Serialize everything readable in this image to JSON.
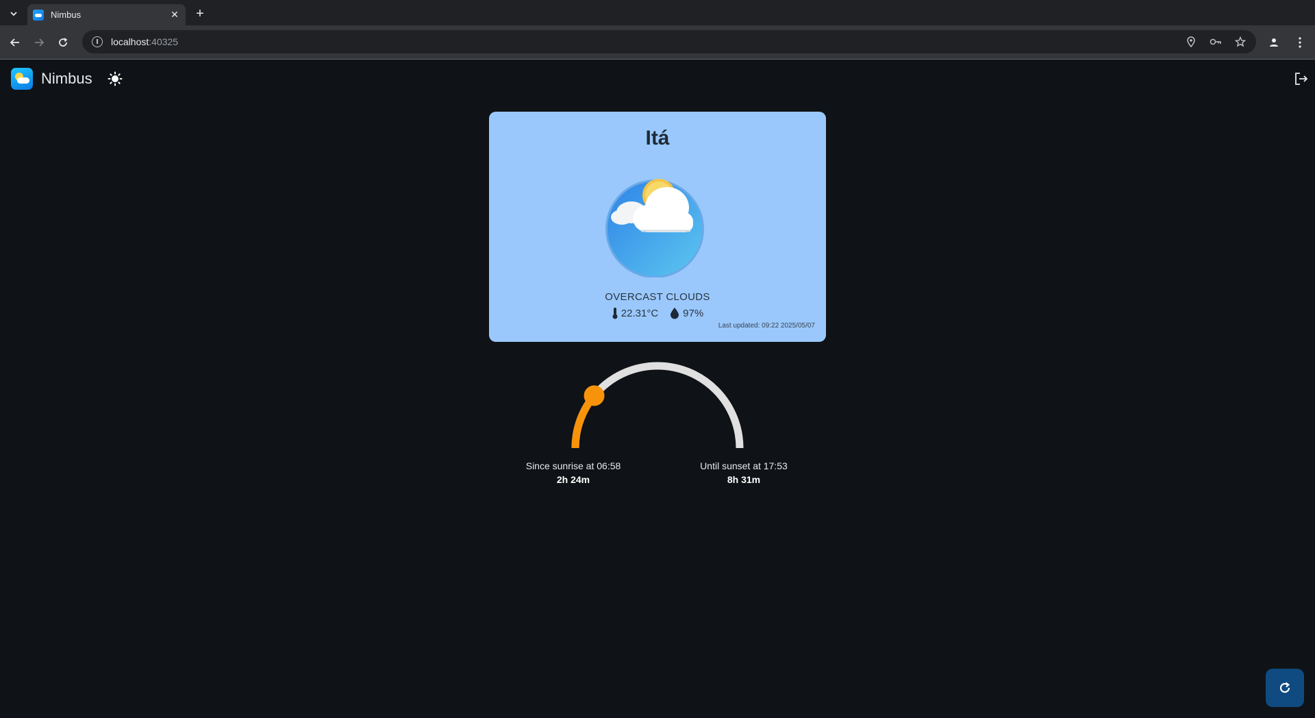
{
  "browser": {
    "tab_title": "Nimbus",
    "url_host": "localhost",
    "url_port": ":40325"
  },
  "app": {
    "name": "Nimbus"
  },
  "weather": {
    "city": "Itá",
    "condition": "OVERCAST CLOUDS",
    "temperature": "22.31°C",
    "humidity": "97%",
    "last_updated": "Last updated: 09:22 2025/05/07"
  },
  "sun": {
    "sunrise_label": "Since sunrise at 06:58",
    "sunrise_elapsed": "2h 24m",
    "sunset_label": "Until sunset at 17:53",
    "sunset_remaining": "8h 31m",
    "day_progress_fraction": 0.22
  },
  "colors": {
    "card_bg": "#9ac8fc",
    "arc_progress": "#f7930a",
    "arc_track": "#e0e0e0",
    "refresh_bg": "#0f4a80"
  },
  "icons": {
    "theme": "sun-icon",
    "logout": "logout-icon",
    "refresh": "refresh-icon",
    "temperature": "thermometer-icon",
    "humidity": "droplet-icon"
  }
}
